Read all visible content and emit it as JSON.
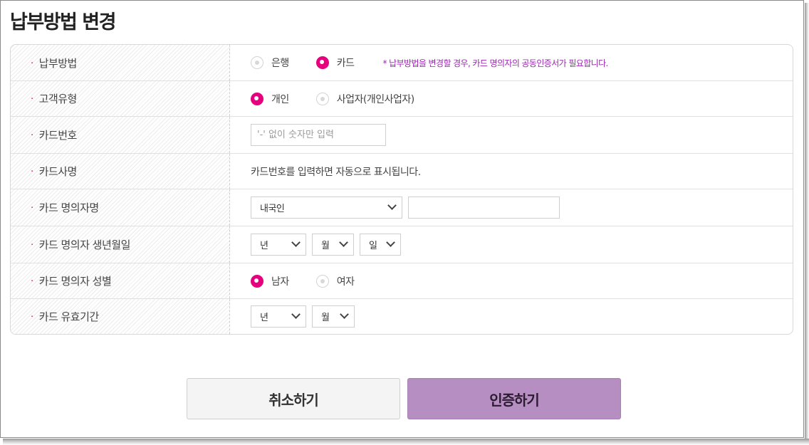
{
  "page_title": "납부방법 변경",
  "form": {
    "payment_method": {
      "label": "납부방법",
      "options": [
        "은행",
        "카드"
      ],
      "selected": "카드",
      "note": "* 납부방법을 변경할 경우, 카드 명의자의 공동인증서가 필요합니다."
    },
    "customer_type": {
      "label": "고객유형",
      "options": [
        "개인",
        "사업자(개인사업자)"
      ],
      "selected": "개인"
    },
    "card_number": {
      "label": "카드번호",
      "placeholder": "'-' 없이 숫자만 입력",
      "value": ""
    },
    "card_company": {
      "label": "카드사명",
      "text": "카드번호를 입력하면 자동으로 표시됩니다."
    },
    "card_holder_name": {
      "label": "카드 명의자명",
      "nationality_selected": "내국인",
      "name_value": ""
    },
    "card_holder_birth": {
      "label": "카드 명의자 생년월일",
      "year": "년",
      "month": "월",
      "day": "일"
    },
    "card_holder_gender": {
      "label": "카드 명의자 성별",
      "options": [
        "남자",
        "여자"
      ],
      "selected": "남자"
    },
    "card_expiry": {
      "label": "카드 유효기간",
      "year": "년",
      "month": "월"
    }
  },
  "buttons": {
    "cancel": "취소하기",
    "authenticate": "인증하기"
  },
  "colors": {
    "accent": "#e6007e",
    "note": "#9b27b0",
    "primary_button": "#b68ec2"
  }
}
